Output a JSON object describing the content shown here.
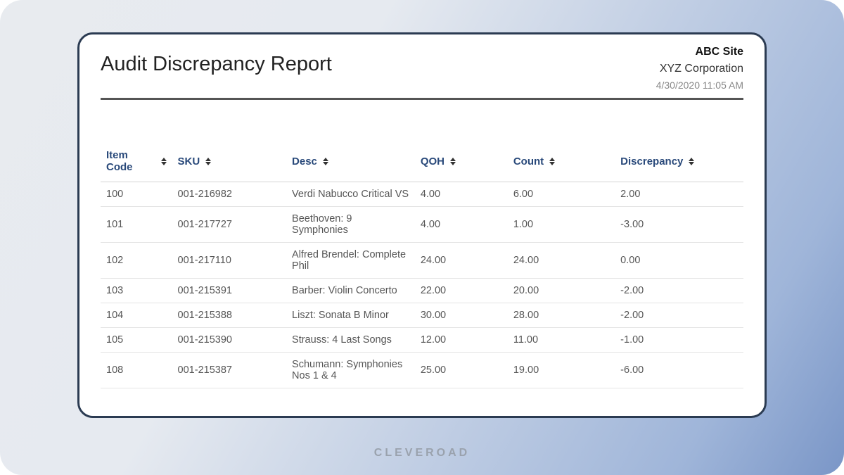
{
  "report": {
    "title": "Audit Discrepancy Report",
    "site": "ABC Site",
    "organization": "XYZ Corporation",
    "timestamp": "4/30/2020 11:05 AM"
  },
  "columns": {
    "item_code": "Item Code",
    "sku": "SKU",
    "desc": "Desc",
    "qoh": "QOH",
    "count": "Count",
    "discrepancy": "Discrepancy"
  },
  "rows": [
    {
      "item_code": "100",
      "sku": "001-216982",
      "desc": "Verdi Nabucco Critical VS",
      "qoh": "4.00",
      "count": "6.00",
      "discrepancy": "2.00"
    },
    {
      "item_code": "101",
      "sku": "001-217727",
      "desc": "Beethoven: 9 Symphonies",
      "qoh": "4.00",
      "count": "1.00",
      "discrepancy": "-3.00"
    },
    {
      "item_code": "102",
      "sku": "001-217110",
      "desc": "Alfred Brendel: Complete Phil",
      "qoh": "24.00",
      "count": "24.00",
      "discrepancy": "0.00"
    },
    {
      "item_code": "103",
      "sku": "001-215391",
      "desc": "Barber: Violin Concerto",
      "qoh": "22.00",
      "count": "20.00",
      "discrepancy": "-2.00"
    },
    {
      "item_code": "104",
      "sku": "001-215388",
      "desc": "Liszt: Sonata B Minor",
      "qoh": "30.00",
      "count": "28.00",
      "discrepancy": "-2.00"
    },
    {
      "item_code": "105",
      "sku": "001-215390",
      "desc": "Strauss: 4 Last Songs",
      "qoh": "12.00",
      "count": "11.00",
      "discrepancy": "-1.00"
    },
    {
      "item_code": "108",
      "sku": "001-215387",
      "desc": "Schumann: Symphonies Nos 1 & 4",
      "qoh": "25.00",
      "count": "19.00",
      "discrepancy": "-6.00"
    }
  ],
  "footer": {
    "brand": "CLEVEROAD"
  }
}
